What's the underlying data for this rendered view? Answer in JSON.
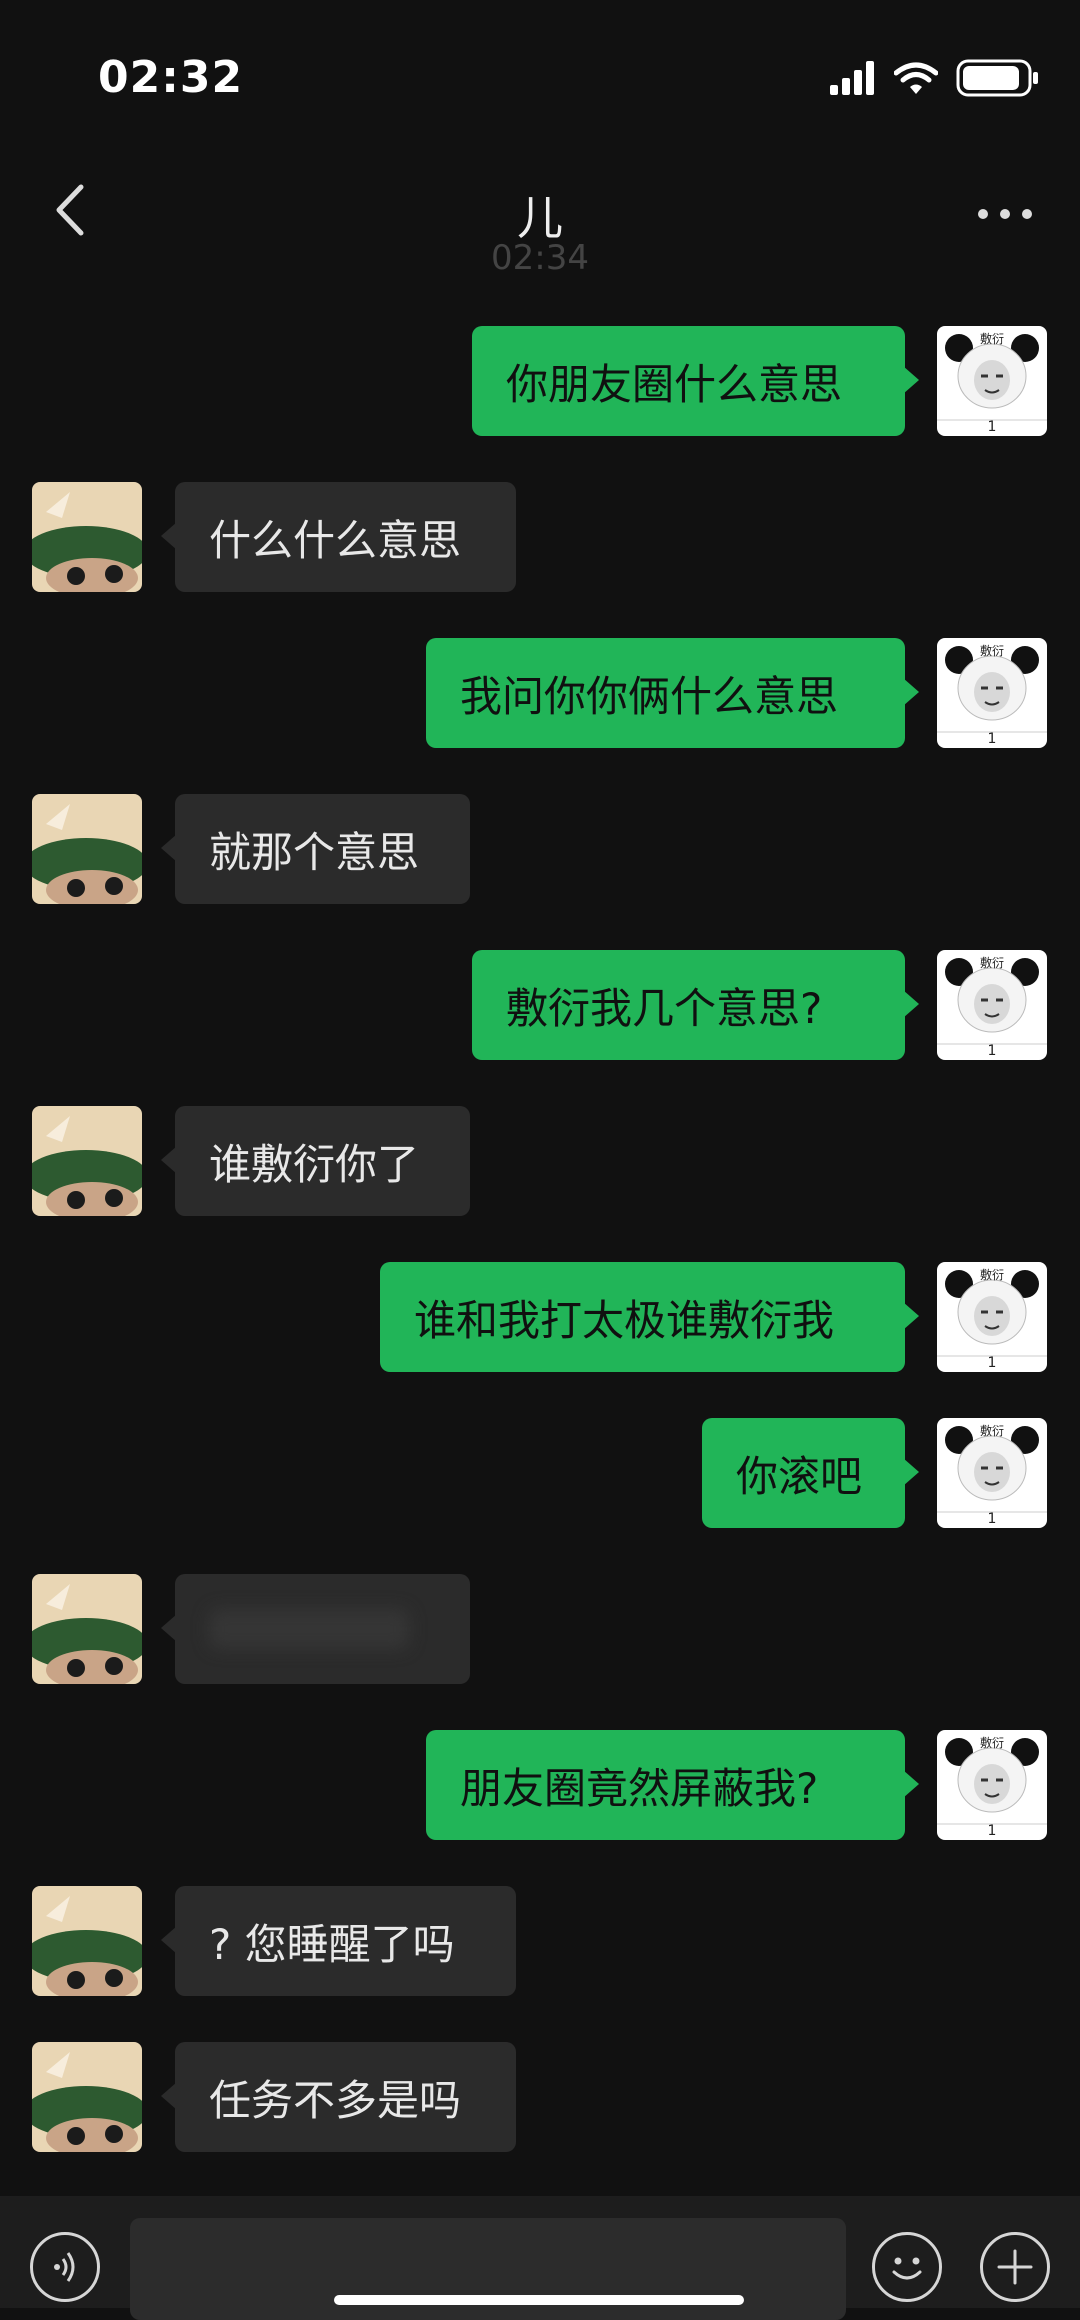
{
  "status_bar": {
    "time": "02:32"
  },
  "header": {
    "title": "儿",
    "faint_timestamp": "02:34"
  },
  "avatars": {
    "sticker_caption": "敷衍",
    "sticker_badge": "1"
  },
  "messages": [
    {
      "side": "out",
      "text": "你朋友圈什么意思"
    },
    {
      "side": "in",
      "text": "什么什么意思"
    },
    {
      "side": "out",
      "text": "我问你你俩什么意思"
    },
    {
      "side": "in",
      "text": "就那个意思"
    },
    {
      "side": "out",
      "text": "敷衍我几个意思?"
    },
    {
      "side": "in",
      "text": "谁敷衍你了"
    },
    {
      "side": "out",
      "text": "谁和我打太极谁敷衍我"
    },
    {
      "side": "out",
      "text": "你滚吧"
    },
    {
      "side": "in",
      "text": "",
      "blurred": true
    },
    {
      "side": "out",
      "text": "朋友圈竟然屏蔽我?"
    },
    {
      "side": "in",
      "text": "? 您睡醒了吗"
    },
    {
      "side": "in",
      "text": "任务不多是吗"
    }
  ],
  "input": {
    "value": "",
    "placeholder": ""
  },
  "colors": {
    "background": "#111111",
    "outgoing_bubble": "#21b558",
    "incoming_bubble": "#2b2b2b",
    "input_bar": "#1d1d1d"
  },
  "icons": [
    "back-icon",
    "more-icon",
    "signal-icon",
    "wifi-icon",
    "battery-icon",
    "voice-icon",
    "emoji-icon",
    "add-icon"
  ]
}
